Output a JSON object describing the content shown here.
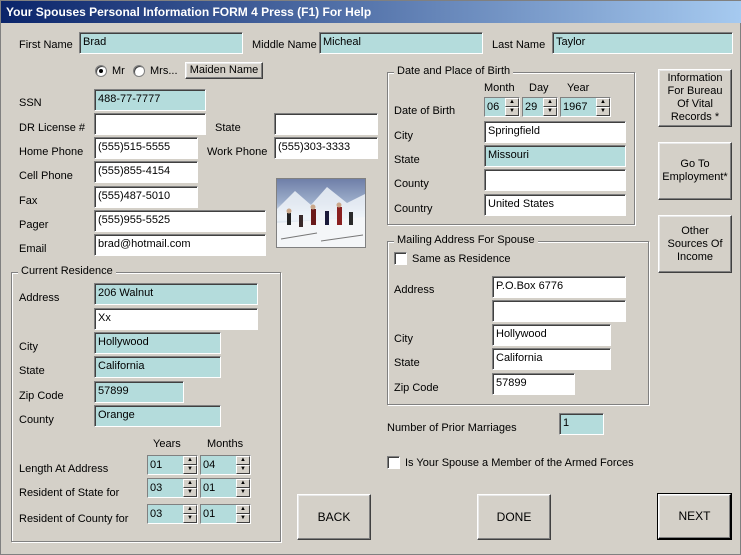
{
  "window": {
    "title": "Your Spouses Personal Information   FORM 4   Press (F1) For Help"
  },
  "name": {
    "first_label": "First Name",
    "first_value": "Brad",
    "middle_label": "Middle Name",
    "middle_value": "Micheal",
    "last_label": "Last Name",
    "last_value": "Taylor"
  },
  "title_radio": {
    "mr_label": "Mr",
    "mrs_label": "Mrs...",
    "selected": "Mr"
  },
  "maiden_button": "Maiden Name",
  "personal": {
    "ssn_label": "SSN",
    "ssn_value": "488-77-7777",
    "dl_label": "DR License #",
    "dl_value": "",
    "state_label": "State",
    "state_value": "",
    "home_label": "Home Phone",
    "home_value": "(555)515-5555",
    "work_label": "Work Phone",
    "work_value": "(555)303-3333",
    "cell_label": "Cell Phone",
    "cell_value": "(555)855-4154",
    "fax_label": "Fax",
    "fax_value": "(555)487-5010",
    "pager_label": "Pager",
    "pager_value": "(555)955-5525",
    "email_label": "Email",
    "email_value": "brad@hotmail.com"
  },
  "residence": {
    "title": "Current Residence",
    "address_label": "Address",
    "address1": "206 Walnut",
    "address2": "Xx",
    "city_label": "City",
    "city_value": "Hollywood",
    "state_label": "State",
    "state_value": "California",
    "zip_label": "Zip Code",
    "zip_value": "57899",
    "county_label": "County",
    "county_value": "Orange",
    "years_label": "Years",
    "months_label": "Months",
    "length_label": "Length At Address",
    "length_years": "01",
    "length_months": "04",
    "state_res_label": "Resident of State for",
    "state_years": "03",
    "state_months": "01",
    "county_res_label": "Resident of County for",
    "county_years": "03",
    "county_months": "01"
  },
  "birth": {
    "title": "Date and Place of Birth",
    "month_label": "Month",
    "day_label": "Day",
    "year_label": "Year",
    "dob_label": "Date of Birth",
    "month_value": "06",
    "day_value": "29",
    "year_value": "1967",
    "city_label": "City",
    "city_value": "Springfield",
    "state_label": "State",
    "state_value": "Missouri",
    "county_label": "County",
    "county_value": "",
    "country_label": "Country",
    "country_value": "United States"
  },
  "mailing": {
    "title": "Mailing Address For Spouse",
    "same_label": "Same as Residence",
    "address_label": "Address",
    "address1": "P.O.Box 6776",
    "address2": "",
    "city_label": "City",
    "city_value": "Hollywood",
    "state_label": "State",
    "state_value": "California",
    "zip_label": "Zip Code",
    "zip_value": "57899"
  },
  "marriages": {
    "label": "Number of Prior Marriages",
    "value": "1"
  },
  "armed_forces": {
    "label": "Is Your Spouse a Member of the Armed Forces"
  },
  "side_buttons": {
    "vital": "Information\nFor Bureau\nOf Vital\nRecords *",
    "employment": "Go To\nEmployment*",
    "income": "Other\nSources Of\nIncome"
  },
  "nav": {
    "back": "BACK",
    "done": "DONE",
    "next": "NEXT"
  },
  "colors": {
    "title_start": "#0a246a",
    "title_end": "#a6caf0",
    "field_teal": "#b4dcdc",
    "window_bg": "#d4d0c8"
  },
  "icons": {
    "photo": "skiers-photo"
  }
}
